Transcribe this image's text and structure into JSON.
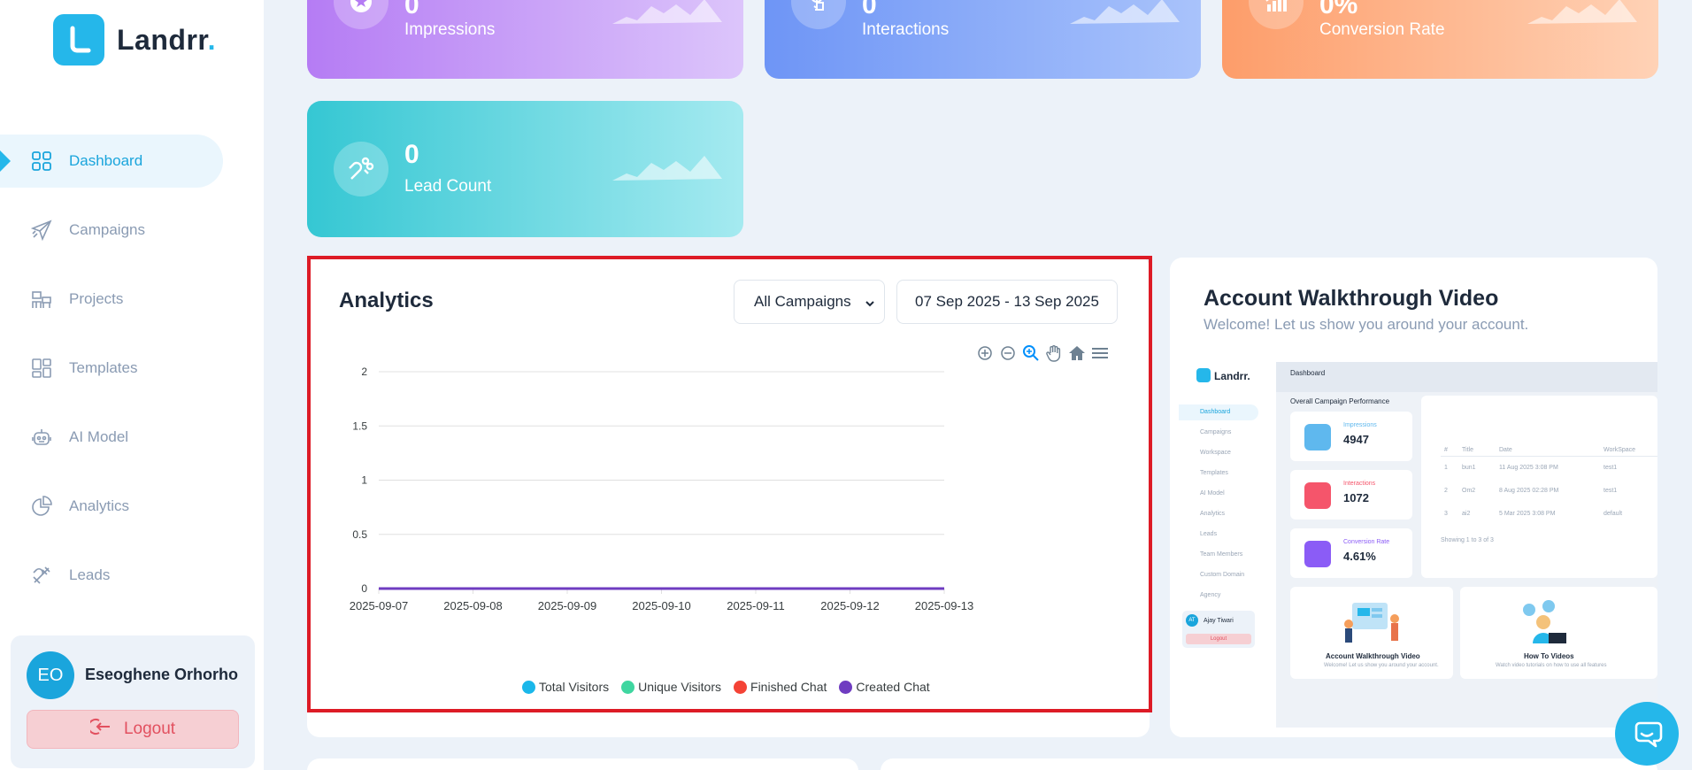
{
  "brand": {
    "name": "Landrr",
    "dot": ".",
    "accent": "#25b7ea"
  },
  "sidebar": {
    "items": [
      {
        "label": "Dashboard",
        "icon": "grid-icon",
        "active": true
      },
      {
        "label": "Campaigns",
        "icon": "paper-plane-icon"
      },
      {
        "label": "Projects",
        "icon": "workspace-icon"
      },
      {
        "label": "Templates",
        "icon": "templates-icon"
      },
      {
        "label": "AI Model",
        "icon": "robot-icon"
      },
      {
        "label": "Analytics",
        "icon": "pie-chart-icon"
      },
      {
        "label": "Leads",
        "icon": "magnet-icon"
      }
    ],
    "user": {
      "initials": "EO",
      "name": "Eseoghene Orhorho",
      "logout_label": "Logout"
    }
  },
  "stats": [
    {
      "value": "0",
      "label": "Impressions",
      "icon": "star-badge-icon",
      "color_from": "#b57cf4",
      "color_to": "#dcc5fb"
    },
    {
      "value": "0",
      "label": "Interactions",
      "icon": "tap-icon",
      "color_from": "#6e95f6",
      "color_to": "#a9c3fb"
    },
    {
      "value": "0%",
      "label": "Conversion Rate",
      "icon": "growth-chart-icon",
      "color_from": "#fd9d6a",
      "color_to": "#ffd2b6"
    },
    {
      "value": "0",
      "label": "Lead Count",
      "icon": "magnet-icon",
      "color_from": "#35c7d3",
      "color_to": "#a5eaf0"
    }
  ],
  "analytics": {
    "title": "Analytics",
    "campaign_select": "All Campaigns",
    "date_range": "07 Sep 2025 - 13 Sep 2025",
    "toolbar": [
      "zoom-in-icon",
      "zoom-out-icon",
      "zoom-select-icon",
      "pan-hand-icon",
      "reset-home-icon",
      "menu-icon"
    ]
  },
  "chart_data": {
    "type": "line",
    "title": "",
    "xlabel": "",
    "ylabel": "",
    "x": [
      "2025-09-07",
      "2025-09-08",
      "2025-09-09",
      "2025-09-10",
      "2025-09-11",
      "2025-09-12",
      "2025-09-13"
    ],
    "y_ticks": [
      "0",
      "0.5",
      "1",
      "1.5",
      "2"
    ],
    "ylim": [
      0,
      2
    ],
    "grid": true,
    "legend_position": "bottom",
    "series": [
      {
        "name": "Total Visitors",
        "color": "#1ab7ea",
        "values": [
          0,
          0,
          0,
          0,
          0,
          0,
          0
        ]
      },
      {
        "name": "Unique Visitors",
        "color": "#3fd6a0",
        "values": [
          0,
          0,
          0,
          0,
          0,
          0,
          0
        ]
      },
      {
        "name": "Finished Chat",
        "color": "#f44336",
        "values": [
          0,
          0,
          0,
          0,
          0,
          0,
          0
        ]
      },
      {
        "name": "Created Chat",
        "color": "#6f3cc1",
        "values": [
          0,
          0,
          0,
          0,
          0,
          0,
          0
        ]
      }
    ]
  },
  "walkthrough": {
    "title": "Account Walkthrough Video",
    "subtitle": "Welcome! Let us show you around your account.",
    "preview": {
      "brand": "Landrr.",
      "header": "Dashboard",
      "section": "Overall Campaign Performance",
      "nav": [
        "Dashboard",
        "Campaigns",
        "Workspace",
        "Templates",
        "AI Model",
        "Analytics",
        "Leads",
        "Team Members",
        "Custom Domain",
        "Agency"
      ],
      "cards": [
        {
          "label": "Impressions",
          "value": "4947",
          "color": "#5fb8ee"
        },
        {
          "label": "Interactions",
          "value": "1072",
          "color": "#f5556b"
        },
        {
          "label": "Conversion Rate",
          "value": "4.61%",
          "color": "#8b5cf6"
        }
      ],
      "table_headers": [
        "#",
        "Title",
        "Date",
        "WorkSpace"
      ],
      "table_rows": [
        [
          "1",
          "bun1",
          "11 Aug 2025 3:08 PM",
          "test1"
        ],
        [
          "2",
          "Om2",
          "8 Aug 2025 02:28 PM",
          "test1"
        ],
        [
          "3",
          "ai2",
          "5 Mar 2025 3:08 PM",
          "default"
        ]
      ],
      "table_footer": "Showing 1 to 3 of 3",
      "user_initials": "AT",
      "user_name": "Ajay Tiwari",
      "logout": "Logout",
      "tile1_title": "Account Walkthrough Video",
      "tile1_sub": "Welcome! Let us show you around your account.",
      "tile2_title": "How To Videos",
      "tile2_sub": "Watch video tutorials on how to use all features"
    }
  }
}
